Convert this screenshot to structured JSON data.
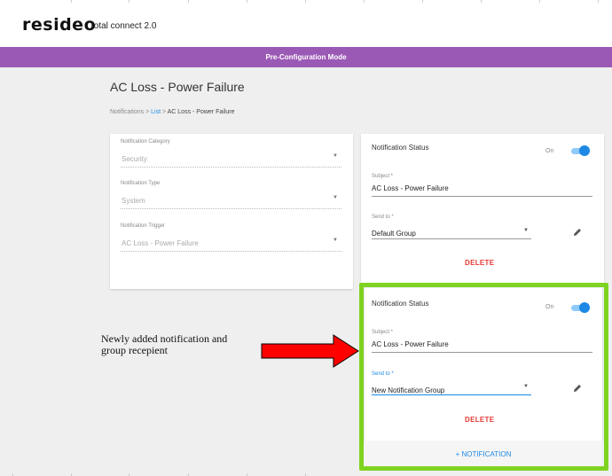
{
  "header": {
    "brand": "resideo",
    "product": "total connect 2.0"
  },
  "mode_banner": "Pre-Configuration Mode",
  "page": {
    "title": "AC Loss - Power Failure",
    "breadcrumb": {
      "root": "Notifications",
      "sep1": " > ",
      "list": "List",
      "sep2": " > ",
      "current": "AC Loss - Power Failure"
    }
  },
  "details": {
    "category_label": "Notification Category",
    "category_value": "Security",
    "type_label": "Notification Type",
    "type_value": "System",
    "trigger_label": "Notification Trigger",
    "trigger_value": "AC Loss - Power Failure"
  },
  "notifications": [
    {
      "status_label": "Notification Status",
      "toggle_label": "On",
      "enabled": true,
      "subject_label": "Subject *",
      "subject_value": "AC Loss - Power Failure",
      "sendto_label": "Send to *",
      "sendto_value": "Default Group",
      "delete_label": "DELETE"
    },
    {
      "status_label": "Notification Status",
      "toggle_label": "On",
      "enabled": true,
      "subject_label": "Subject *",
      "subject_value": "AC Loss - Power Failure",
      "sendto_label": "Send to *",
      "sendto_value": "New Notification Group",
      "delete_label": "DELETE"
    }
  ],
  "add_notification_label": "+ NOTIFICATION",
  "annotation": {
    "line1": "Newly added notification and",
    "line2": "group recepient"
  },
  "colors": {
    "mode_banner": "#9b59b6",
    "accent": "#1e88e5",
    "delete": "#e53935",
    "highlight": "#7ed321",
    "arrow": "#ff0000"
  },
  "icons": {
    "dropdown": "caret-down-icon",
    "edit": "pencil-icon",
    "arrow": "right-arrow-icon"
  }
}
